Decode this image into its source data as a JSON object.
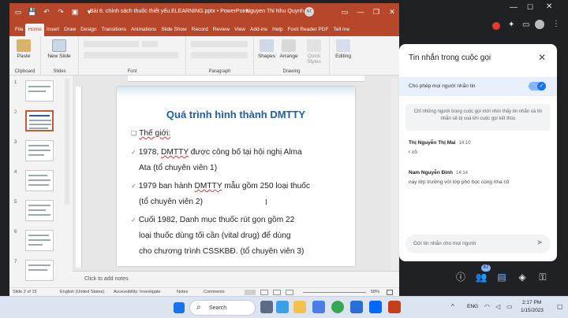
{
  "ppt": {
    "doc_title": "Bài 8. chính sách thuốc thiết yếu.ELEARNING.pptx • PowerPoint",
    "user_name": "Nguyen Thi Nhu Quynh",
    "user_initials": "NT",
    "menu": [
      "File",
      "Home",
      "Insert",
      "Draw",
      "Design",
      "Transitions",
      "Animations",
      "Slide Show",
      "Record",
      "Review",
      "View",
      "Add-ins",
      "Help",
      "Foxit Reader PDF",
      "Tell me"
    ],
    "ribbon": {
      "paste": "Paste",
      "clipboard": "Clipboard",
      "new_slide": "New Slide",
      "slides": "Slides",
      "font": "Font",
      "paragraph": "Paragraph",
      "shapes": "Shapes",
      "arrange": "Arrange",
      "quick_styles": "Quick Styles",
      "drawing": "Drawing",
      "editing": "Editing"
    },
    "thumb_numbers": [
      "1",
      "2",
      "3",
      "4",
      "5",
      "6",
      "7"
    ],
    "slide": {
      "title": "Quá trình hình thành DMTTY",
      "line1": "Thế giới:",
      "line2a": "1978, ",
      "line2b": "DMTTY",
      "line2c": " được công bố tại hội nghị Alma",
      "line3": "Ata (tổ chuyên viên 1)",
      "line4a": "1979 ban hành ",
      "line4b": "DMTTY",
      "line4c": " mẫu gồm 250 loại thuốc",
      "line5": "(tổ chuyên viên 2)",
      "line6": "Cuối 1982, Danh mục thuốc rút gọn gồm 22",
      "line7": "loại thuốc dùng tối cần (vital drug) để dùng",
      "line8": "cho chương trình CSSKBĐ. (tổ chuyên viên 3)"
    },
    "notes_placeholder": "Click to add notes",
    "status": {
      "slide_of": "Slide 2 of 15",
      "language": "English (United States)",
      "accessibility": "Accessibility: Investigate",
      "notes": "Notes",
      "comments": "Comments",
      "zoom": "58%"
    }
  },
  "meet": {
    "panel_title": "Tin nhắn trong cuộc gọi",
    "allow_label": "Cho phép mọi người nhắn tin",
    "allow_on": true,
    "info": "Chỉ những người trong cuộc gọi mới nhìn thấy tin nhắn và tin nhắn sẽ bị xoá khi cuộc gọi kết thúc",
    "messages": [
      {
        "name": "Thị Nguyễn Thị Mai",
        "time": "14:10",
        "text": "r cô"
      },
      {
        "name": "Nam Nguyễn Đình",
        "time": "14:14",
        "text": "nay lớp trưởng với lớp phó học cùng nha cô"
      }
    ],
    "send_placeholder": "Gửi tin nhắn cho mọi người",
    "participants_badge": "47"
  },
  "taskbar": {
    "search_label": "Search",
    "language": "ENG",
    "time": "2:17 PM",
    "date": "1/15/2023"
  }
}
